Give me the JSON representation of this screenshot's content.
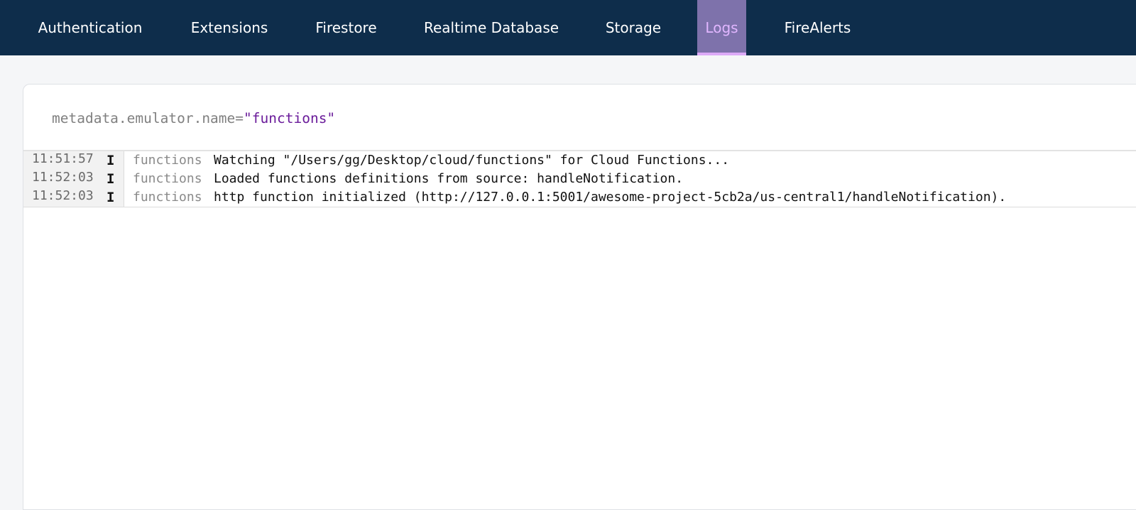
{
  "nav": {
    "tabs": [
      {
        "label": "Authentication",
        "active": false
      },
      {
        "label": "Extensions",
        "active": false
      },
      {
        "label": "Firestore",
        "active": false
      },
      {
        "label": "Realtime Database",
        "active": false
      },
      {
        "label": "Storage",
        "active": false
      },
      {
        "label": "Logs",
        "active": true
      },
      {
        "label": "FireAlerts",
        "active": false
      }
    ]
  },
  "query": {
    "key": "metadata.emulator.name=",
    "value": "\"functions\""
  },
  "logs": [
    {
      "time": "11:51:57",
      "level": "I",
      "source": "functions",
      "message": "Watching \"/Users/gg/Desktop/cloud/functions\" for Cloud Functions..."
    },
    {
      "time": "11:52:03",
      "level": "I",
      "source": "functions",
      "message": "Loaded functions definitions from source: handleNotification."
    },
    {
      "time": "11:52:03",
      "level": "I",
      "source": "functions",
      "message": "http function initialized (http://127.0.0.1:5001/awesome-project-5cb2a/us-central1/handleNotification)."
    }
  ],
  "colors": {
    "nav_bg": "#0e2d4b",
    "active_tab_bg": "#7e72ab",
    "active_tab_text": "#e1b6ff",
    "query_string": "#6a1b9a"
  }
}
